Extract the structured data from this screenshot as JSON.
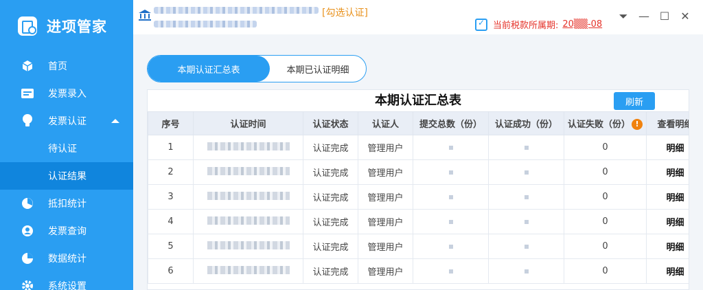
{
  "app": {
    "name": "进项管家"
  },
  "sidebar": {
    "items": [
      {
        "label": "首页",
        "icon": "cube-icon"
      },
      {
        "label": "发票录入",
        "icon": "keyboard-icon"
      },
      {
        "label": "发票认证",
        "icon": "lightbulb-icon"
      },
      {
        "label": "待认证",
        "icon": ""
      },
      {
        "label": "认证结果",
        "icon": ""
      },
      {
        "label": "抵扣统计",
        "icon": "pie-chart-icon"
      },
      {
        "label": "发票查询",
        "icon": "user-icon"
      },
      {
        "label": "数据统计",
        "icon": "pie-chart-icon"
      },
      {
        "label": "系统设置",
        "icon": "gear-icon"
      }
    ]
  },
  "header": {
    "select_cert": "[勾选认证]",
    "period_label": "当前税款所属期:",
    "period_value": "20▒▒-08"
  },
  "tabs": [
    {
      "label": "本期认证汇总表"
    },
    {
      "label": "本期已认证明细"
    }
  ],
  "summary": {
    "title": "本期认证汇总表",
    "refresh_label": "刷新",
    "columns": [
      "序号",
      "认证时间",
      "认证状态",
      "认证人",
      "提交总数（份）",
      "认证成功（份）",
      "认证失败（份）",
      "查看明细"
    ],
    "rows": [
      {
        "no": "1",
        "status": "认证完成",
        "user": "管理用户",
        "failed": "0",
        "detail": "明细"
      },
      {
        "no": "2",
        "status": "认证完成",
        "user": "管理用户",
        "failed": "0",
        "detail": "明细"
      },
      {
        "no": "3",
        "status": "认证完成",
        "user": "管理用户",
        "failed": "0",
        "detail": "明细"
      },
      {
        "no": "4",
        "status": "认证完成",
        "user": "管理用户",
        "failed": "0",
        "detail": "明细"
      },
      {
        "no": "5",
        "status": "认证完成",
        "user": "管理用户",
        "failed": "0",
        "detail": "明细"
      },
      {
        "no": "6",
        "status": "认证完成",
        "user": "管理用户",
        "failed": "0",
        "detail": "明细"
      }
    ]
  },
  "colors": {
    "primary": "#2a9ef2",
    "active_nav": "#1085dd",
    "warning": "#f0820f",
    "period_red": "#e5332a"
  }
}
